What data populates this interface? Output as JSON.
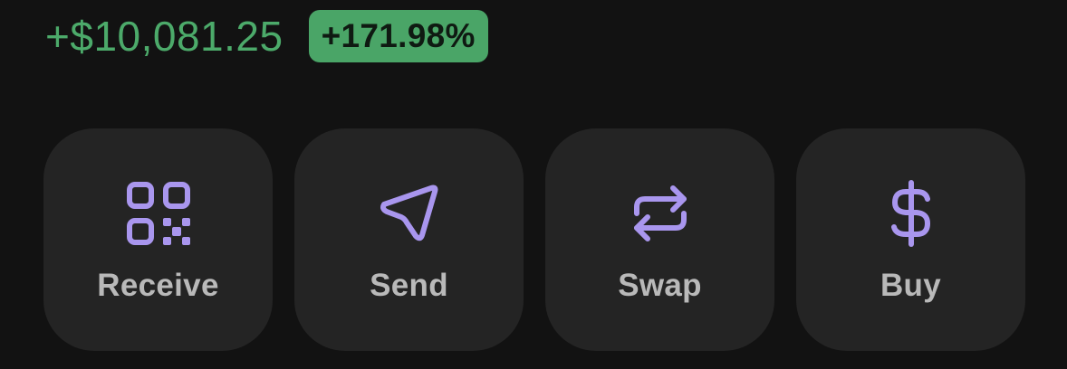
{
  "pnl": {
    "amount": "+$10,081.25",
    "percent": "+171.98%"
  },
  "colors": {
    "positive": "#4caa6a",
    "accent": "#a996ee",
    "tile": "#242424"
  },
  "actions": [
    {
      "label": "Receive",
      "icon": "qr-code-icon"
    },
    {
      "label": "Send",
      "icon": "send-icon"
    },
    {
      "label": "Swap",
      "icon": "swap-arrows-icon"
    },
    {
      "label": "Buy",
      "icon": "dollar-icon"
    }
  ]
}
